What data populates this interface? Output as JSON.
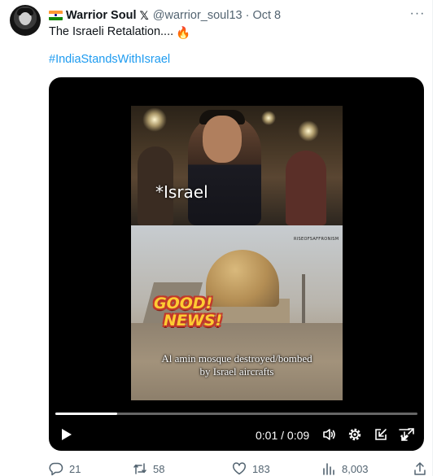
{
  "author": {
    "flag_icon": "india-flag-icon",
    "display_name": "Warrior Soul",
    "x_badge": "𝕏",
    "handle": "@warrior_soul13",
    "separator": "·",
    "date": "Oct 8"
  },
  "more_menu": {
    "icon": "more-horizontal-icon",
    "label": "···"
  },
  "tweet": {
    "text": "The Israeli Retalation....",
    "emoji": "🔥",
    "hashtag": "#IndiaStandsWithIsrael"
  },
  "video": {
    "top_caption": "*Israel",
    "watermark": "RISEOFSAFFRONISM",
    "badge_line1": "GOOD!",
    "badge_line2": "NEWS!",
    "caption_line1": "Al amin mosque destroyed/bombed",
    "caption_line2": "by Israel aircrafts",
    "time_readout": "0:01 / 0:09",
    "progress_fraction": 0.17,
    "controls": {
      "play": "play-icon",
      "volume": "volume-icon",
      "settings": "gear-icon",
      "popout": "popout-icon",
      "download": "download-icon",
      "fullscreen": "fullscreen-icon"
    }
  },
  "actions": {
    "replies": {
      "icon": "reply-icon",
      "count": "21"
    },
    "reposts": {
      "icon": "repost-icon",
      "count": "58"
    },
    "likes": {
      "icon": "heart-icon",
      "count": "183"
    },
    "views": {
      "icon": "views-icon",
      "count": "8,003"
    },
    "share": {
      "icon": "share-icon"
    }
  },
  "colors": {
    "text": "#0f1419",
    "secondary": "#536471",
    "link": "#1d9bf0",
    "media_bg": "#000000"
  }
}
